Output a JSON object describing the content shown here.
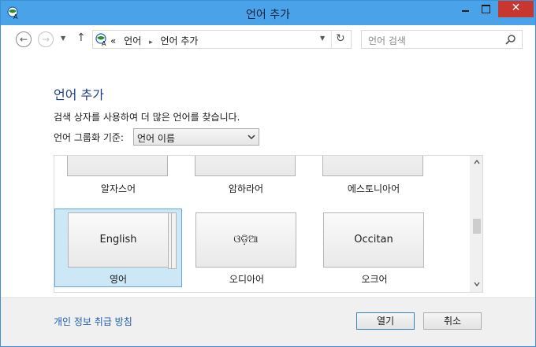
{
  "window": {
    "title": "언어 추가"
  },
  "titlebar": {
    "close_glyph": "✕"
  },
  "address_bar": {
    "prefix": "«",
    "breadcrumb": [
      "언어",
      "언어 추가"
    ],
    "separator": "▸"
  },
  "search": {
    "placeholder": "언어 검색"
  },
  "content": {
    "heading": "언어 추가",
    "description": "검색 상자를 사용하여 더 많은 언어를 찾습니다.",
    "group_label": "언어 그룹화 기준:",
    "group_value": "언어 이름"
  },
  "languages": {
    "row1": [
      {
        "label": "알자스어"
      },
      {
        "label": "암하라어"
      },
      {
        "label": "에스토니아어"
      }
    ],
    "row2": [
      {
        "native": "English",
        "label": "영어",
        "selected": true
      },
      {
        "native": "ଓଡ଼ିଆ",
        "label": "오디아어",
        "selected": false
      },
      {
        "native": "Occitan",
        "label": "오크어",
        "selected": false
      }
    ]
  },
  "footer": {
    "privacy_link": "개인 정보 취급 방침",
    "open_button": "열기",
    "cancel_button": "취소"
  },
  "colors": {
    "titlebar": "#4aa3e8",
    "close": "#c7372f",
    "heading": "#1e3e8a",
    "link": "#1e5fb0",
    "selection": "#cce8f7"
  }
}
